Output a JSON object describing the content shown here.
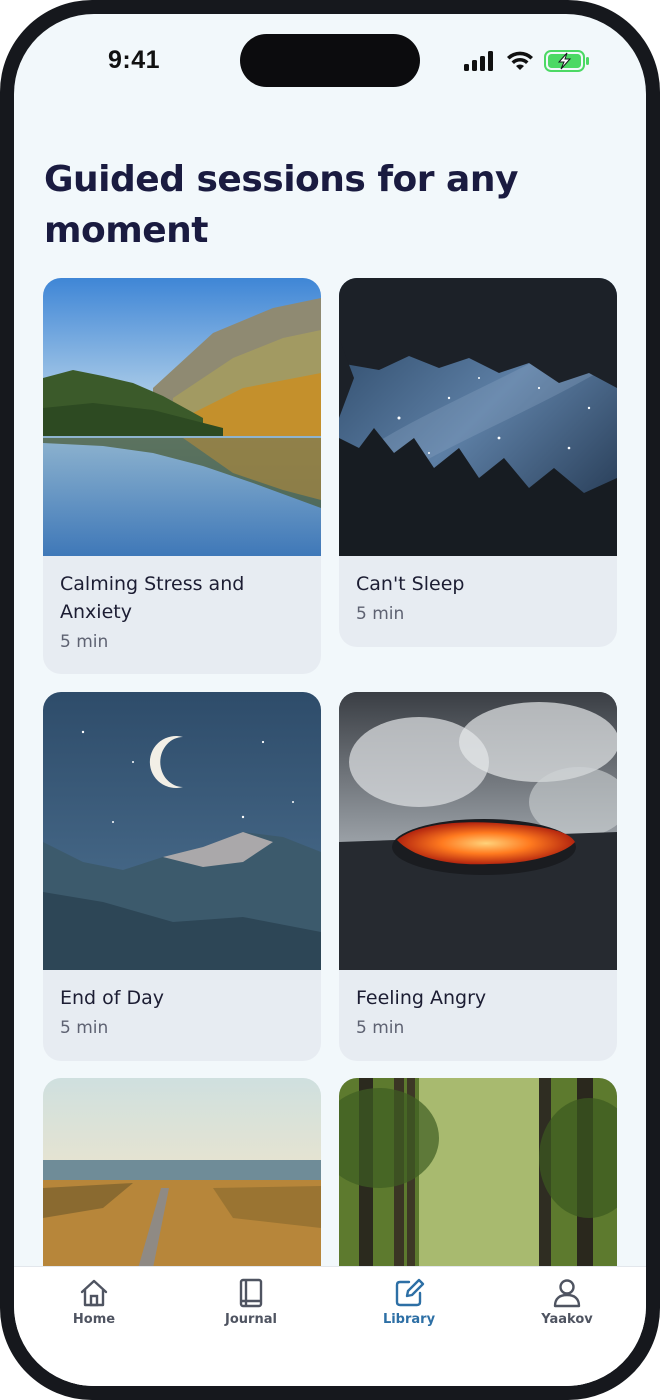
{
  "status_bar": {
    "time": "9:41",
    "icons": [
      "signal-icon",
      "wifi-icon",
      "battery-charging-icon"
    ],
    "battery_color": "#4cd964"
  },
  "page": {
    "title": "Guided sessions for any moment"
  },
  "sessions": [
    {
      "title": "Calming Stress and Anxiety",
      "duration": "5 min",
      "image": "mountain-lake-image"
    },
    {
      "title": "Can't Sleep",
      "duration": "5 min",
      "image": "starry-forest-image"
    },
    {
      "title": "End of Day",
      "duration": "5 min",
      "image": "moon-mountain-image"
    },
    {
      "title": "Feeling Angry",
      "duration": "5 min",
      "image": "lava-volcano-image"
    },
    {
      "title": "",
      "duration": "",
      "image": "coastal-boardwalk-image"
    },
    {
      "title": "",
      "duration": "",
      "image": "forest-path-image"
    }
  ],
  "tab_bar": {
    "tabs": [
      {
        "label": "Home",
        "icon": "home-icon",
        "active": false
      },
      {
        "label": "Journal",
        "icon": "book-icon",
        "active": false
      },
      {
        "label": "Library",
        "icon": "edit-square-icon",
        "active": true
      },
      {
        "label": "Yaakov",
        "icon": "user-icon",
        "active": false
      }
    ],
    "active_color": "#2d6fa5",
    "inactive_color": "#4f5461"
  }
}
